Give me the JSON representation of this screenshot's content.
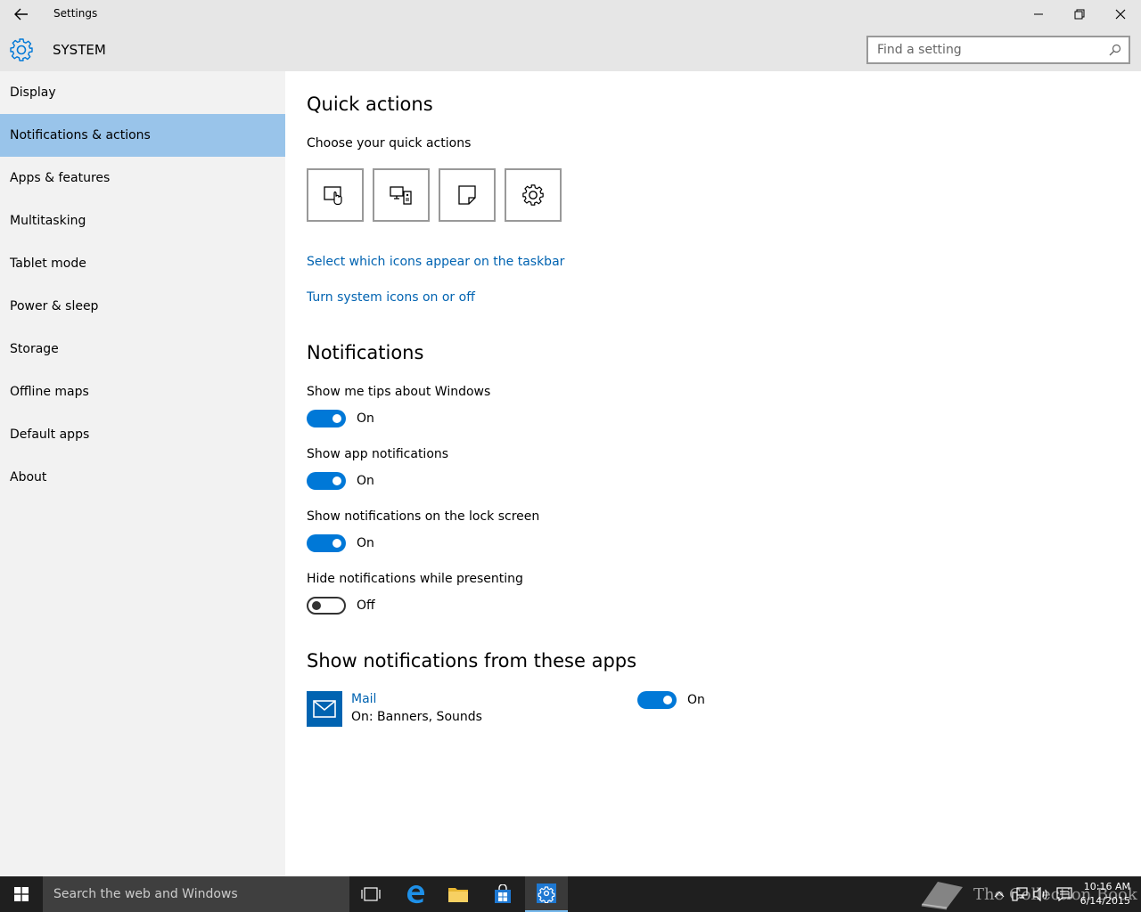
{
  "window": {
    "title": "Settings"
  },
  "header": {
    "section": "SYSTEM",
    "search_placeholder": "Find a setting"
  },
  "sidebar": {
    "items": [
      {
        "label": "Display"
      },
      {
        "label": "Notifications & actions"
      },
      {
        "label": "Apps & features"
      },
      {
        "label": "Multitasking"
      },
      {
        "label": "Tablet mode"
      },
      {
        "label": "Power & sleep"
      },
      {
        "label": "Storage"
      },
      {
        "label": "Offline maps"
      },
      {
        "label": "Default apps"
      },
      {
        "label": "About"
      }
    ],
    "active_index": 1
  },
  "quick_actions": {
    "heading": "Quick actions",
    "subheading": "Choose your quick actions",
    "tiles": [
      "tablet-mode-icon",
      "connect-icon",
      "note-icon",
      "settings-icon"
    ],
    "link_taskbar_icons": "Select which icons appear on the taskbar",
    "link_system_icons": "Turn system icons on or off"
  },
  "notifications": {
    "heading": "Notifications",
    "settings": [
      {
        "label": "Show me tips about Windows",
        "state": "On",
        "on": true
      },
      {
        "label": "Show app notifications",
        "state": "On",
        "on": true
      },
      {
        "label": "Show notifications on the lock screen",
        "state": "On",
        "on": true
      },
      {
        "label": "Hide notifications while presenting",
        "state": "Off",
        "on": false
      }
    ]
  },
  "apps": {
    "heading": "Show notifications from these apps",
    "items": [
      {
        "name": "Mail",
        "detail": "On: Banners, Sounds",
        "state": "On",
        "on": true
      }
    ]
  },
  "taskbar": {
    "search_placeholder": "Search the web and Windows",
    "time": "10:16 AM",
    "date": "6/14/2015",
    "watermark": "The Collection Book"
  },
  "colors": {
    "accent": "#0078d7",
    "link": "#0063b1",
    "selected_nav": "#99c4ea"
  }
}
